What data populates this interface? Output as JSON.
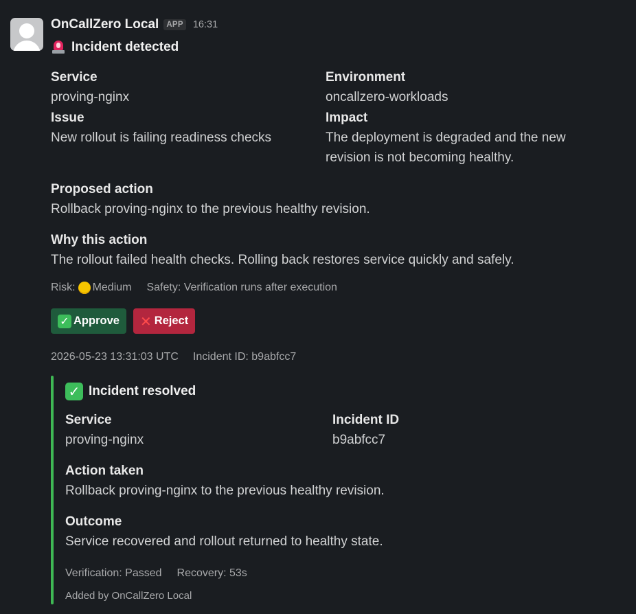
{
  "message": {
    "sender": "OnCallZero Local",
    "app_badge": "APP",
    "time": "16:31",
    "title": "Incident detected",
    "title_icon": "rotating-light-icon",
    "fields": {
      "service_label": "Service",
      "service_value": "proving-nginx",
      "environment_label": "Environment",
      "environment_value": "oncallzero-workloads",
      "issue_label": "Issue",
      "issue_value": "New rollout is failing readiness checks",
      "impact_label": "Impact",
      "impact_value_line1": "The deployment is degraded and the new",
      "impact_value_line2": "revision is not becoming healthy."
    },
    "proposed_action": {
      "label": "Proposed action",
      "value": "Rollback proving-nginx to the previous healthy revision."
    },
    "why_action": {
      "label": "Why this action",
      "value": "The rollout failed health checks. Rolling back restores service quickly and safely."
    },
    "context": {
      "risk_prefix": "Risk:",
      "risk_value": "Medium",
      "risk_icon": "yellow-circle-icon",
      "safety": "Safety: Verification runs after execution"
    },
    "buttons": {
      "approve_label": "Approve",
      "reject_label": "Reject"
    },
    "meta": {
      "timestamp": "2026-05-23 13:31:03 UTC",
      "incident_id": "Incident ID: b9abfcc7"
    }
  },
  "attachment": {
    "title": "Incident resolved",
    "title_icon": "white-check-mark-icon",
    "accent_color": "#3fb854",
    "service_label": "Service",
    "service_value": "proving-nginx",
    "incident_id_label": "Incident ID",
    "incident_id_value": "b9abfcc7",
    "action_taken_label": "Action taken",
    "action_taken_value": "Rollback proving-nginx to the previous healthy revision.",
    "outcome_label": "Outcome",
    "outcome_value": "Service recovered and rollout returned to healthy state.",
    "verification": "Verification: Passed",
    "recovery": "Recovery: 53s",
    "footer": "Added by OnCallZero Local"
  },
  "colors": {
    "background": "#1a1d21",
    "approve_button": "#1f5b3c",
    "reject_button": "#b3263e"
  }
}
